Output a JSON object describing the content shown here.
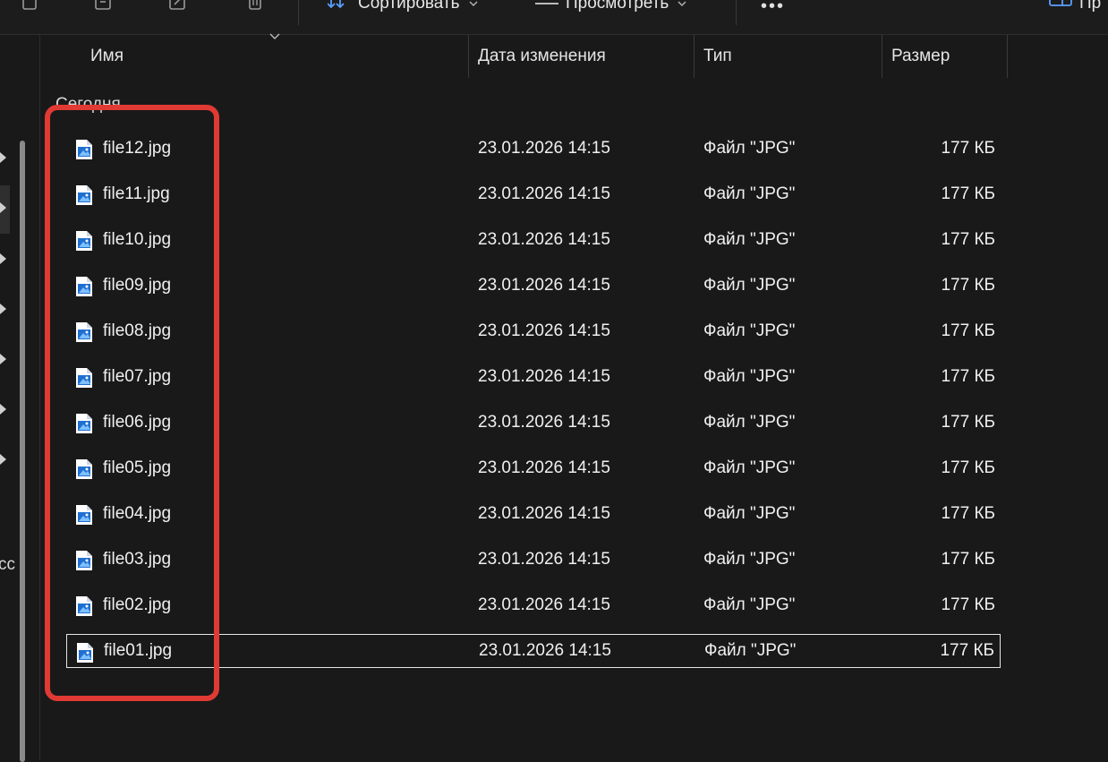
{
  "toolbar": {
    "sort_label": "Сортировать",
    "view_label": "Просмотреть",
    "more_label": "•••",
    "right_partial_label": "Пр"
  },
  "nav": {
    "partial_text": "сс"
  },
  "columns": {
    "name": "Имя",
    "date": "Дата изменения",
    "type": "Тип",
    "size": "Размер"
  },
  "group": {
    "label": "Сегодня"
  },
  "files": [
    {
      "name": "file12.jpg",
      "date": "23.01.2026 14:15",
      "type": "Файл \"JPG\"",
      "size": "177 КБ"
    },
    {
      "name": "file11.jpg",
      "date": "23.01.2026 14:15",
      "type": "Файл \"JPG\"",
      "size": "177 КБ"
    },
    {
      "name": "file10.jpg",
      "date": "23.01.2026 14:15",
      "type": "Файл \"JPG\"",
      "size": "177 КБ"
    },
    {
      "name": "file09.jpg",
      "date": "23.01.2026 14:15",
      "type": "Файл \"JPG\"",
      "size": "177 КБ"
    },
    {
      "name": "file08.jpg",
      "date": "23.01.2026 14:15",
      "type": "Файл \"JPG\"",
      "size": "177 КБ"
    },
    {
      "name": "file07.jpg",
      "date": "23.01.2026 14:15",
      "type": "Файл \"JPG\"",
      "size": "177 КБ"
    },
    {
      "name": "file06.jpg",
      "date": "23.01.2026 14:15",
      "type": "Файл \"JPG\"",
      "size": "177 КБ"
    },
    {
      "name": "file05.jpg",
      "date": "23.01.2026 14:15",
      "type": "Файл \"JPG\"",
      "size": "177 КБ"
    },
    {
      "name": "file04.jpg",
      "date": "23.01.2026 14:15",
      "type": "Файл \"JPG\"",
      "size": "177 КБ"
    },
    {
      "name": "file03.jpg",
      "date": "23.01.2026 14:15",
      "type": "Файл \"JPG\"",
      "size": "177 КБ"
    },
    {
      "name": "file02.jpg",
      "date": "23.01.2026 14:15",
      "type": "Файл \"JPG\"",
      "size": "177 КБ"
    },
    {
      "name": "file01.jpg",
      "date": "23.01.2026 14:15",
      "type": "Файл \"JPG\"",
      "size": "177 КБ"
    }
  ],
  "selected_file": "file01.jpg",
  "colors": {
    "background": "#191919",
    "highlight": "#e03a34",
    "accent": "#5aa0ff"
  }
}
